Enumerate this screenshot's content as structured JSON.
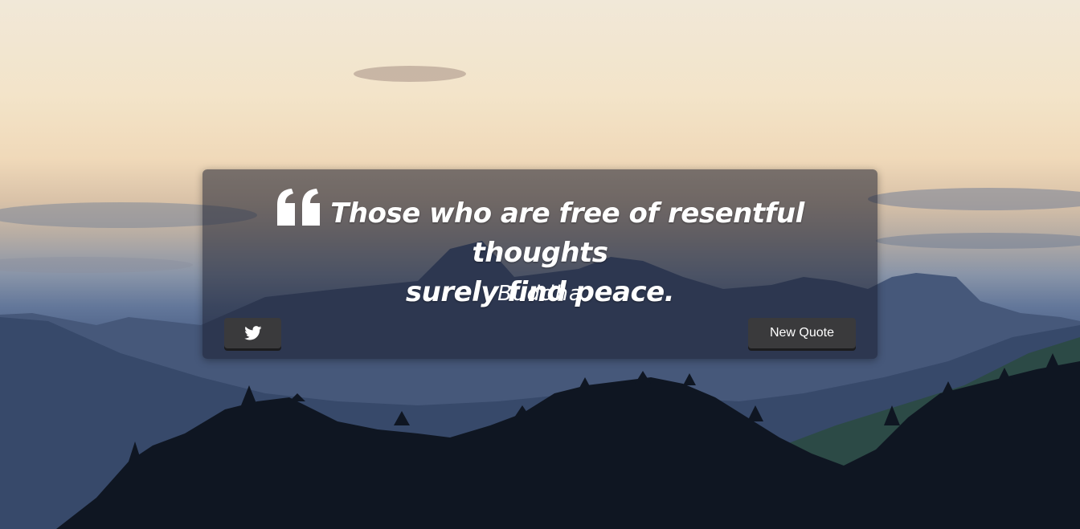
{
  "quote": {
    "text_line1": "Those who are free of resentful thoughts",
    "text_line2": "surely find peace.",
    "author": "Buddha",
    "quote_mark_icon": "left-double-quote-icon"
  },
  "actions": {
    "tweet_icon": "twitter-icon",
    "new_quote_label": "New Quote"
  },
  "theme": {
    "box_color": "#191e2d",
    "button_color": "#3a3a3c",
    "text_color": "#ffffff"
  }
}
